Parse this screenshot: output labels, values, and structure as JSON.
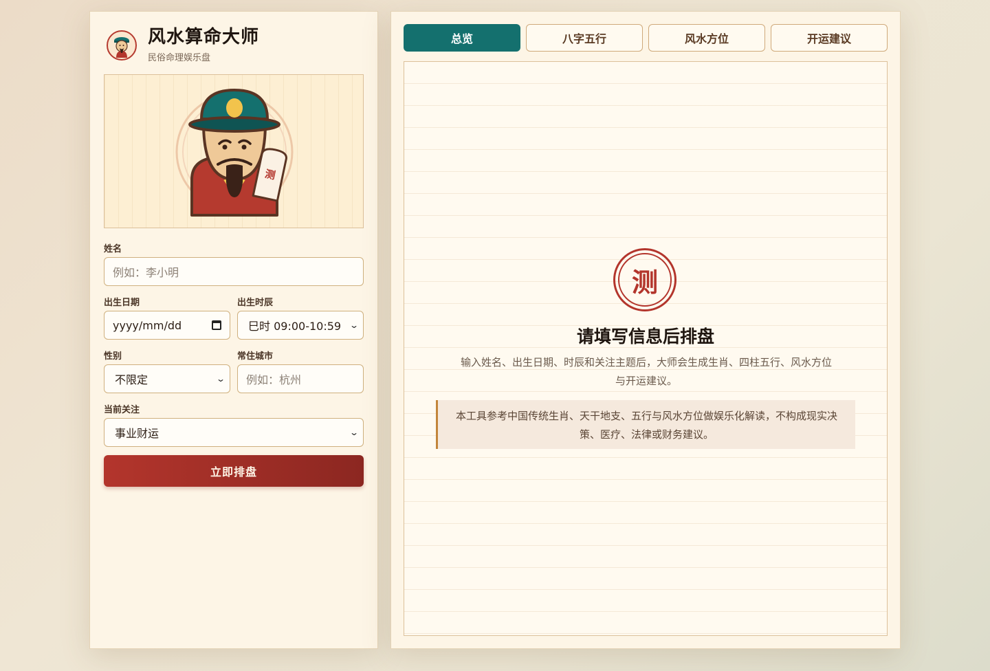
{
  "brand": {
    "title": "风水算命大师",
    "subtitle": "民俗命理娱乐盘",
    "logo_icon": "fortune-teller-avatar-icon"
  },
  "hero": {
    "illustration": "fortune-teller-illustration",
    "sign_text": "测"
  },
  "form": {
    "name": {
      "label": "姓名",
      "placeholder": "例如：李小明"
    },
    "birth_date": {
      "label": "出生日期",
      "value": "yyyy/mm/dd"
    },
    "birth_hour": {
      "label": "出生时辰",
      "value": "巳时 09:00-10:59"
    },
    "gender": {
      "label": "性别",
      "value": "不限定"
    },
    "city": {
      "label": "常住城市",
      "placeholder": "例如：杭州"
    },
    "focus": {
      "label": "当前关注",
      "value": "事业财运"
    },
    "submit_label": "立即排盘"
  },
  "tabs": [
    {
      "label": "总览",
      "active": true
    },
    {
      "label": "八字五行",
      "active": false
    },
    {
      "label": "风水方位",
      "active": false
    },
    {
      "label": "开运建议",
      "active": false
    }
  ],
  "empty_state": {
    "seal_text": "测",
    "title": "请填写信息后排盘",
    "description": "输入姓名、出生日期、时辰和关注主题后，大师会生成生肖、四柱五行、风水方位与开运建议。",
    "disclaimer": "本工具参考中国传统生肖、天干地支、五行与风水方位做娱乐化解读，不构成现实决策、医疗、法律或财务建议。"
  },
  "colors": {
    "accent_teal": "#14706e",
    "accent_red": "#b3352c",
    "panel_bg": "#fdf5e6"
  }
}
